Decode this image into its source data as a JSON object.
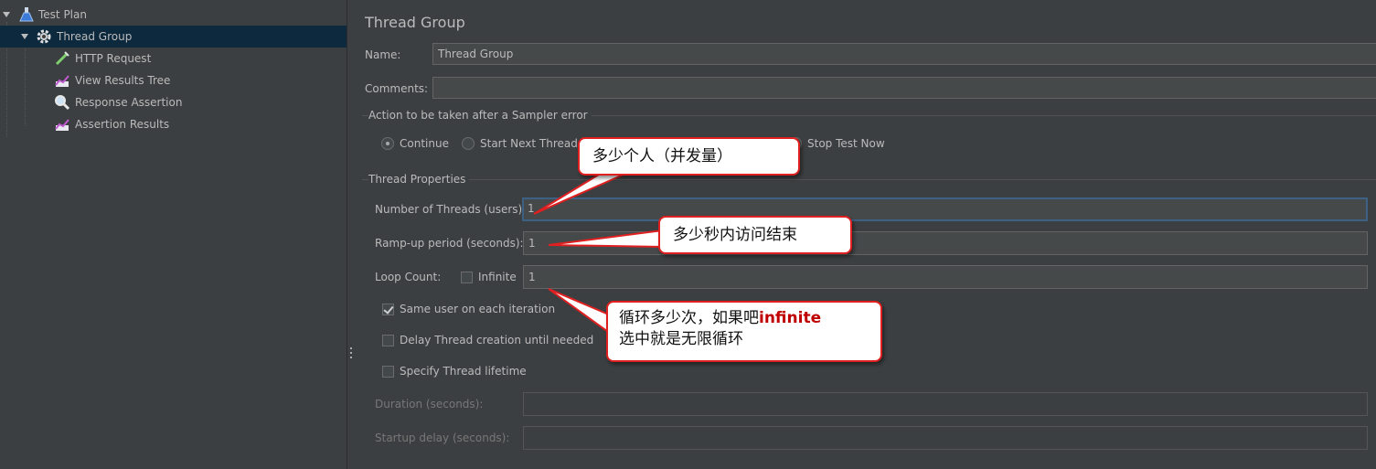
{
  "tree": {
    "items": [
      {
        "label": "Test Plan",
        "icon": "flask-icon"
      },
      {
        "label": "Thread Group",
        "icon": "gear-icon"
      },
      {
        "label": "HTTP Request",
        "icon": "pipette-icon"
      },
      {
        "label": "View Results Tree",
        "icon": "chart-icon"
      },
      {
        "label": "Response Assertion",
        "icon": "magnifier-icon"
      },
      {
        "label": "Assertion Results",
        "icon": "chart-icon"
      }
    ]
  },
  "panel": {
    "title": "Thread Group",
    "name_label": "Name:",
    "name_value": "Thread Group",
    "comments_label": "Comments:",
    "comments_value": "",
    "sampler_error": {
      "title": "Action to be taken after a Sampler error",
      "options": [
        "Continue",
        "Start Next Thread Lo",
        "Stop Test Now"
      ],
      "selected": "Continue"
    },
    "thread_props": {
      "title": "Thread Properties",
      "threads_label": "Number of Threads (users):",
      "threads_value": "1",
      "rampup_label": "Ramp-up period (seconds):",
      "rampup_value": "1",
      "loop_label": "Loop Count:",
      "infinite_label": "Infinite",
      "loop_value": "1",
      "same_user_label": "Same user on each iteration",
      "delay_label": "Delay Thread creation until needed",
      "lifetime_label": "Specify Thread lifetime",
      "duration_label": "Duration (seconds):",
      "startup_label": "Startup delay (seconds):"
    }
  },
  "annotations": {
    "threads_note": "多少个人（并发量）",
    "rampup_note": "多少秒内访问结束",
    "loop_note_a": "循环多少次，如果吧",
    "loop_note_em": "infinite",
    "loop_note_b": "选中就是无限循环"
  },
  "colors": {
    "background": "#3c3f41",
    "selection": "#0d293e",
    "callout_border": "#e02020"
  }
}
